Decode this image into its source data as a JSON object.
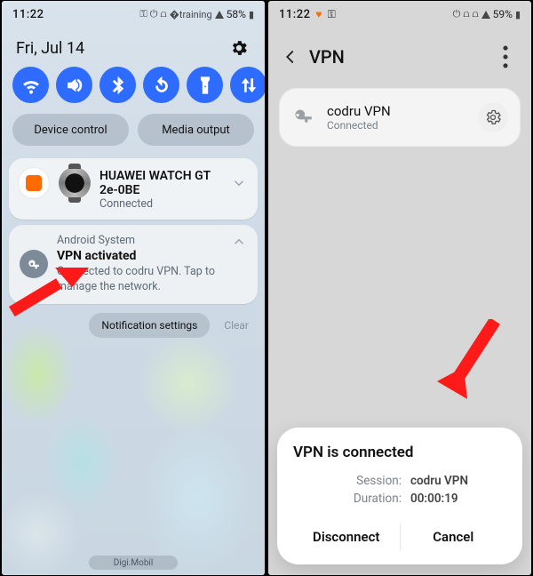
{
  "left": {
    "status": {
      "time": "11:22",
      "battery": "58%"
    },
    "date": "Fri, Jul 14",
    "controls": {
      "device": "Device control",
      "media": "Media output"
    },
    "notif1": {
      "title": "HUAWEI WATCH GT 2e-0BE",
      "sub": "Connected"
    },
    "notif2": {
      "head": "Android System",
      "title": "VPN activated",
      "body": "Connected to codru VPN. Tap to manage the network."
    },
    "chips": {
      "settings": "Notification settings",
      "clear": "Clear"
    },
    "carrier": "Digi.Mobil"
  },
  "right": {
    "status": {
      "time": "11:22",
      "battery": "59%"
    },
    "title": "VPN",
    "vpn": {
      "name": "codru VPN",
      "status": "Connected"
    },
    "dialog": {
      "title": "VPN is connected",
      "session_label": "Session:",
      "session_value": "codru VPN",
      "duration_label": "Duration:",
      "duration_value": "00:00:19",
      "disconnect": "Disconnect",
      "cancel": "Cancel"
    }
  }
}
